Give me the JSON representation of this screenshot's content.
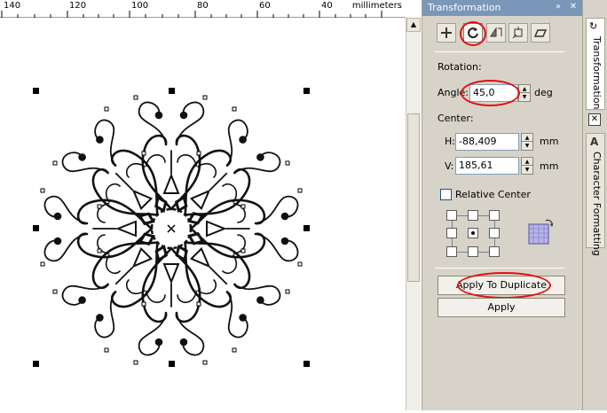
{
  "ruler": {
    "ticks": [
      "140",
      "120",
      "100",
      "80",
      "60",
      "40"
    ],
    "unit": "millimeters"
  },
  "panel": {
    "title": "Transformation",
    "tools": [
      {
        "name": "position-tool",
        "icon": "move-icon"
      },
      {
        "name": "rotate-tool",
        "icon": "rotate-icon",
        "active": true
      },
      {
        "name": "scale-mirror-tool",
        "icon": "mirror-icon"
      },
      {
        "name": "size-tool",
        "icon": "size-icon"
      },
      {
        "name": "skew-tool",
        "icon": "skew-icon"
      }
    ],
    "rotation_label": "Rotation:",
    "angle_label": "Angle:",
    "angle_value": "45,0",
    "angle_unit": "deg",
    "center_label": "Center:",
    "h_label": "H:",
    "h_value": "-88,409",
    "h_unit": "mm",
    "v_label": "V:",
    "v_value": "185,61",
    "v_unit": "mm",
    "relative_center_label": "Relative Center",
    "relative_center_checked": false,
    "apply_duplicate_label": "Apply To Duplicate",
    "apply_label": "Apply"
  },
  "sidebar": {
    "tabs": [
      {
        "label": "Transformation",
        "active": true
      },
      {
        "label": "Character Formatting",
        "active": false
      }
    ]
  },
  "colors": {
    "header": "#7a96b9",
    "panel": "#d7d3c8",
    "highlight": "#e01010"
  }
}
